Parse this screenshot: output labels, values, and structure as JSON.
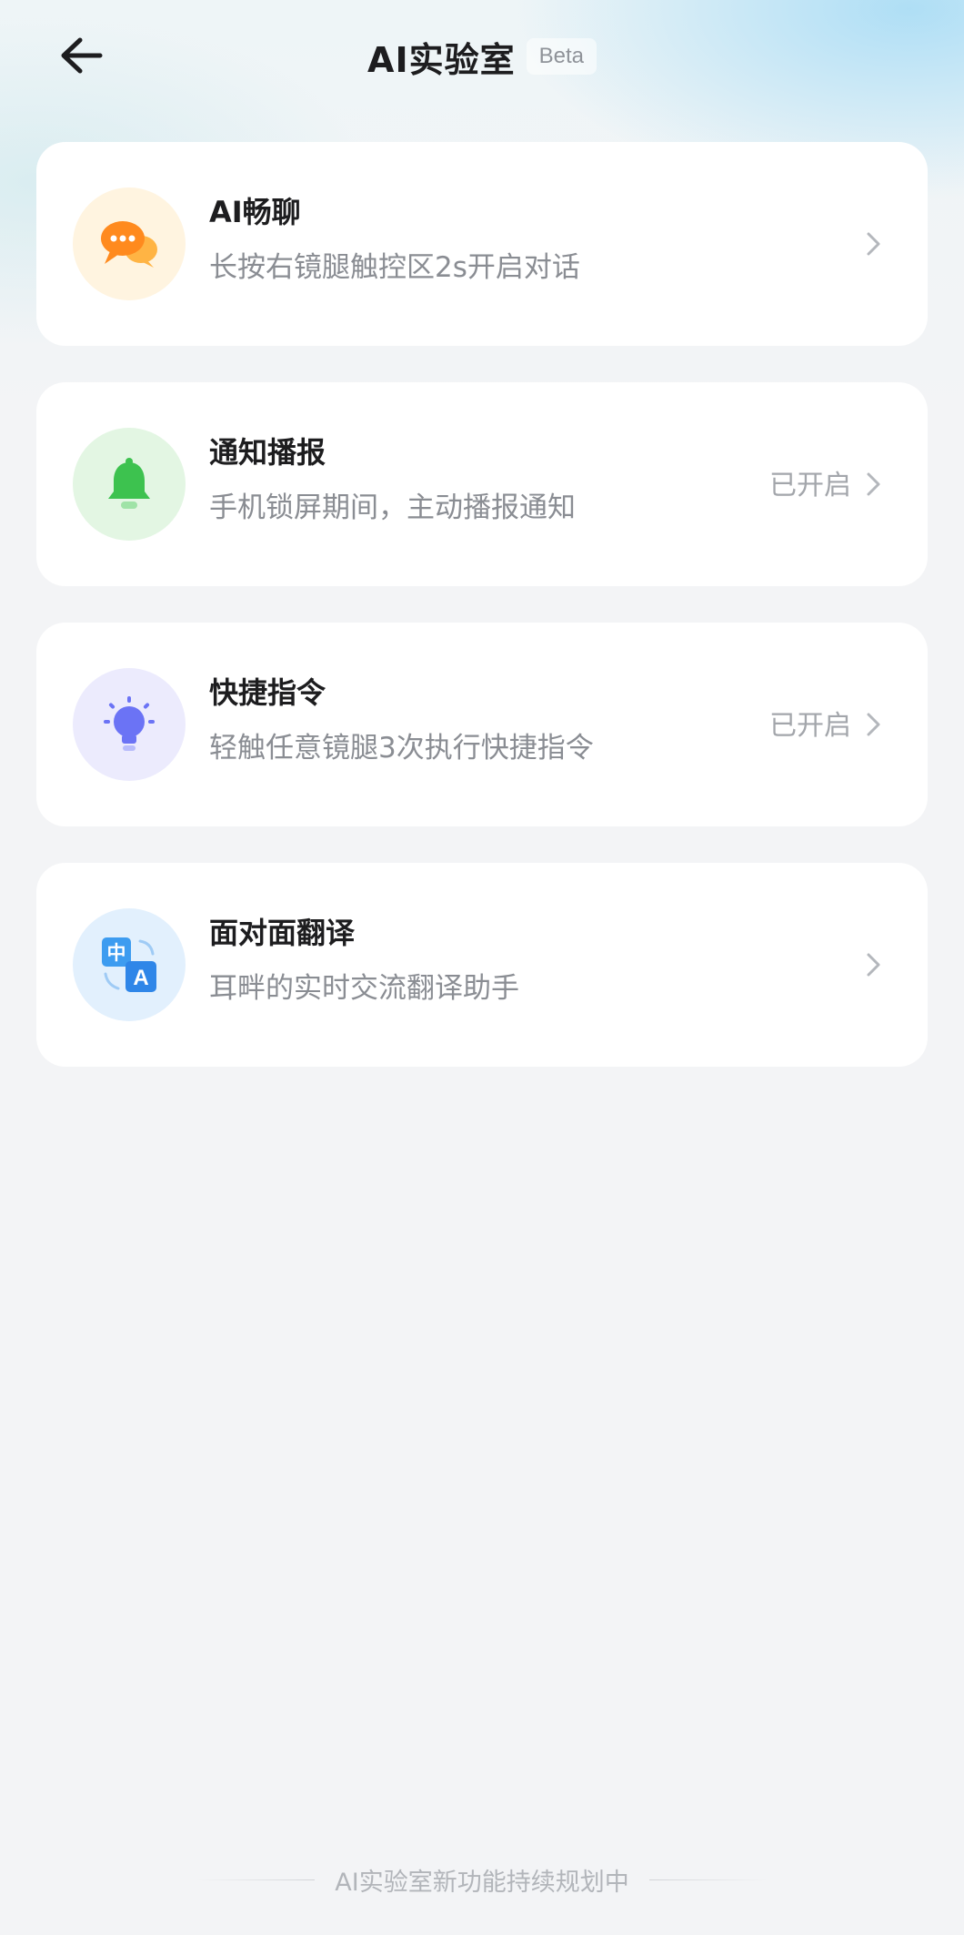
{
  "header": {
    "title": "AI实验室",
    "badge": "Beta"
  },
  "features": [
    {
      "title": "AI畅聊",
      "desc": "长按右镜腿触控区2s开启对话",
      "status": "",
      "icon": "chat-bubbles-icon",
      "icon_bg": "#fff4e0"
    },
    {
      "title": "通知播报",
      "desc": "手机锁屏期间，主动播报通知",
      "status": "已开启",
      "icon": "bell-icon",
      "icon_bg": "#e3f6e3"
    },
    {
      "title": "快捷指令",
      "desc": "轻触任意镜腿3次执行快捷指令",
      "status": "已开启",
      "icon": "lightbulb-icon",
      "icon_bg": "#ecebfd"
    },
    {
      "title": "面对面翻译",
      "desc": "耳畔的实时交流翻译助手",
      "status": "",
      "icon": "translate-icon",
      "icon_bg": "#e2f0fd"
    }
  ],
  "footer": {
    "text": "AI实验室新功能持续规划中"
  }
}
